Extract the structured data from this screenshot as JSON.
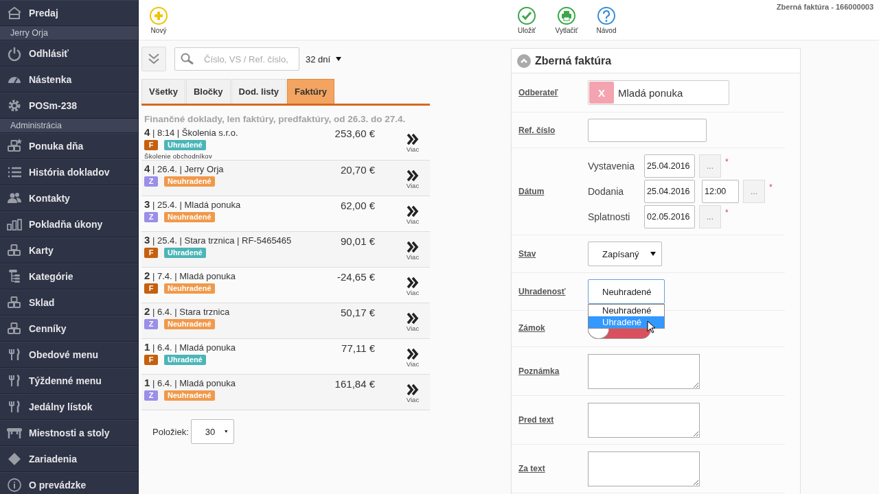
{
  "sidebar": {
    "items": [
      {
        "kind": "link",
        "label": "Predaj"
      },
      {
        "kind": "header",
        "label": "Jerry Orja"
      },
      {
        "kind": "link",
        "label": "Odhlásiť"
      },
      {
        "kind": "link",
        "label": "Nástenka"
      },
      {
        "kind": "link",
        "label": "POSm-238"
      },
      {
        "kind": "header",
        "label": "Administrácia"
      },
      {
        "kind": "link",
        "label": "Ponuka dňa"
      },
      {
        "kind": "link",
        "label": "História dokladov"
      },
      {
        "kind": "link",
        "label": "Kontakty"
      },
      {
        "kind": "link",
        "label": "Pokladňa úkony"
      },
      {
        "kind": "link",
        "label": "Karty"
      },
      {
        "kind": "link",
        "label": "Kategórie"
      },
      {
        "kind": "link",
        "label": "Sklad"
      },
      {
        "kind": "link",
        "label": "Cenníky"
      },
      {
        "kind": "link",
        "label": "Obedové menu"
      },
      {
        "kind": "link",
        "label": "Týždenné menu"
      },
      {
        "kind": "link",
        "label": "Jedálny lístok"
      },
      {
        "kind": "link",
        "label": "Miestnosti a stoly"
      },
      {
        "kind": "link",
        "label": "Zariadenia"
      },
      {
        "kind": "link",
        "label": "O prevádzke"
      }
    ]
  },
  "toolbar": {
    "left": [
      {
        "kind": "new",
        "label": "Nový"
      }
    ],
    "right": [
      {
        "kind": "save",
        "label": "Uložiť"
      },
      {
        "kind": "print",
        "label": "Vytlačiť"
      },
      {
        "kind": "help",
        "label": "Návod"
      }
    ],
    "title": "Zberná faktúra - 166000003"
  },
  "search": {
    "placeholder": "Číslo, VS / Ref. číslo,",
    "period": "32 dní"
  },
  "tabs": [
    {
      "label": "Všetky",
      "selected": false
    },
    {
      "label": "Bločky",
      "selected": false
    },
    {
      "label": "Dod. listy",
      "selected": false
    },
    {
      "label": "Faktúry",
      "selected": true
    }
  ],
  "caption": "Finančné doklady, len faktúry, predfaktúry, od 26.3. do 27.4.",
  "documents": [
    {
      "title": "**4** | 8:14 | Školenia s.r.o.",
      "amount": "253,60 €",
      "type": {
        "letter": "F",
        "color": "#c5600f"
      },
      "status": {
        "label": "Uhradené",
        "color": "#4bb5b7"
      },
      "note": "Školenie obchodníkov",
      "more": "Viac"
    },
    {
      "title": "**4** | 26.4. | Jerry Orja",
      "amount": "20,70 €",
      "type": {
        "letter": "Z",
        "color": "#9b8ee8"
      },
      "status": {
        "label": "Neuhradené",
        "color": "#f0994a"
      },
      "more": "Viac"
    },
    {
      "title": "**3** | 25.4. | Mladá ponuka",
      "amount": "62,00 €",
      "type": {
        "letter": "Z",
        "color": "#9b8ee8"
      },
      "status": {
        "label": "Neuhradené",
        "color": "#f0994a"
      },
      "more": "Viac"
    },
    {
      "title": "**3** | 25.4. | Stara trznica | RF-5465465",
      "amount": "90,01 €",
      "type": {
        "letter": "F",
        "color": "#c5600f"
      },
      "status": {
        "label": "Uhradené",
        "color": "#4bb5b7"
      },
      "more": "Viac"
    },
    {
      "title": "**2** | 7.4. | Mladá ponuka",
      "amount": "-24,65 €",
      "type": {
        "letter": "F",
        "color": "#c5600f"
      },
      "status": {
        "label": "Neuhradené",
        "color": "#f0994a"
      },
      "more": "Viac"
    },
    {
      "title": "**2** | 6.4. | Stara trznica",
      "amount": "50,17 €",
      "type": {
        "letter": "Z",
        "color": "#9b8ee8"
      },
      "status": {
        "label": "Neuhradené",
        "color": "#f0994a"
      },
      "more": "Viac"
    },
    {
      "title": "**1** | 6.4. | Mladá ponuka",
      "amount": "77,11 €",
      "type": {
        "letter": "F",
        "color": "#c5600f"
      },
      "status": {
        "label": "Uhradené",
        "color": "#4bb5b7"
      },
      "more": "Viac"
    },
    {
      "title": "**1** | 6.4. | Mladá ponuka",
      "amount": "161,84 €",
      "type": {
        "letter": "Z",
        "color": "#9b8ee8"
      },
      "status": {
        "label": "Neuhradené",
        "color": "#f0994a"
      },
      "more": "Viac"
    }
  ],
  "pager": {
    "label": "Položiek:",
    "value": "30"
  },
  "form": {
    "title": "Zberná faktúra",
    "expanded": true,
    "customer": {
      "label": "Odberateľ",
      "remove": "X",
      "value": "Mladá ponuka"
    },
    "ref": {
      "label": "Ref. číslo"
    },
    "dates": {
      "label": "Dátum",
      "rows": [
        {
          "label": "Vystavenia",
          "date": "25.04.2016",
          "picker": "...",
          "required": "*"
        },
        {
          "label": "Dodania",
          "date": "25.04.2016",
          "time": "12:00",
          "picker": "...",
          "required": "*"
        },
        {
          "label": "Splatnosti",
          "date": "02.05.2016",
          "picker": "...",
          "required": "*"
        }
      ]
    },
    "state": {
      "label": "Stav",
      "value": "Zapísaný"
    },
    "payment": {
      "label": "Uhradenosť",
      "value": "Neuhradené",
      "options": [
        {
          "label": "Neuhradené",
          "highlighted": false
        },
        {
          "label": "Uhradené",
          "highlighted": true
        }
      ]
    },
    "lock": {
      "label": "Zámok",
      "on": false
    },
    "notes": [
      {
        "label": "Poznámka"
      },
      {
        "label": "Pred text"
      },
      {
        "label": "Za text"
      }
    ]
  }
}
